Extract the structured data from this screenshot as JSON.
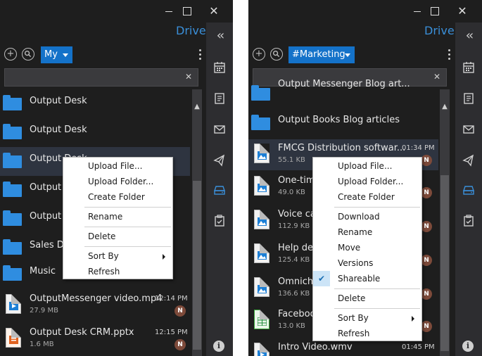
{
  "panel1": {
    "title": "Drive",
    "dropdown": "My",
    "search": {
      "value": "",
      "placeholder": ""
    },
    "items": [
      {
        "name": "Output Desk",
        "type": "folder"
      },
      {
        "name": "Output Desk",
        "type": "folder"
      },
      {
        "name": "Output Desk",
        "type": "folder"
      },
      {
        "name": "Output T",
        "type": "folder"
      },
      {
        "name": "Output",
        "type": "folder"
      },
      {
        "name": "Sales Da",
        "type": "folder"
      },
      {
        "name": "Music",
        "type": "folder"
      },
      {
        "name": "OutputMessenger video.mp4",
        "type": "video",
        "time": "12:14 PM",
        "size": "27.9 MB",
        "badge": "N"
      },
      {
        "name": "Output Desk CRM.pptx",
        "type": "pptx",
        "time": "12:15 PM",
        "size": "1.6 MB",
        "badge": "N"
      }
    ],
    "menu": [
      {
        "label": "Upload File..."
      },
      {
        "label": "Upload Folder..."
      },
      {
        "label": "Create Folder"
      },
      {
        "label": "Rename"
      },
      {
        "label": "Delete"
      },
      {
        "label": "Sort By",
        "submenu": true
      },
      {
        "label": "Refresh"
      }
    ]
  },
  "panel2": {
    "title": "Drive",
    "dropdown": "#Marketing",
    "search": {
      "value": "",
      "placeholder": ""
    },
    "items": [
      {
        "name": "Output Messenger Blog art...",
        "type": "folder"
      },
      {
        "name": "Output Books Blog articles",
        "type": "folder"
      },
      {
        "name": "FMCG Distribution softwar...",
        "type": "image",
        "time": "01:34 PM",
        "size": "55.1 KB",
        "badge": "N"
      },
      {
        "name": "One-tim",
        "type": "image",
        "size": "49.0 KB",
        "badge": "N"
      },
      {
        "name": "Voice ca",
        "type": "image",
        "size": "112.9 KB",
        "badge": "N"
      },
      {
        "name": "Help des",
        "type": "image",
        "size": "125.4 KB",
        "badge": "N"
      },
      {
        "name": "Omnicha",
        "type": "image",
        "size": "136.6 KB",
        "badge": "N"
      },
      {
        "name": "Faceboo",
        "type": "sheet",
        "size": "13.0 KB",
        "badge": "N"
      },
      {
        "name": "Intro Video.wmv",
        "type": "video",
        "time": "01:45 PM"
      }
    ],
    "menu": [
      {
        "label": "Upload File..."
      },
      {
        "label": "Upload Folder..."
      },
      {
        "label": "Create Folder"
      },
      {
        "label": "Download"
      },
      {
        "label": "Rename"
      },
      {
        "label": "Move"
      },
      {
        "label": "Versions"
      },
      {
        "label": "Shareable",
        "checked": true
      },
      {
        "label": "Delete"
      },
      {
        "label": "Sort By",
        "submenu": true
      },
      {
        "label": "Refresh"
      }
    ]
  },
  "sidebar_icons": [
    "collapse-icon",
    "calendar-icon",
    "notes-icon",
    "mail-icon",
    "announcement-icon",
    "drive-icon",
    "tasks-icon",
    "info-icon"
  ],
  "colors": {
    "accent": "#1472c9",
    "link": "#3a8fd9",
    "folder": "#2f8de0",
    "background": "#1e1e1e",
    "sidebar": "#2d2d30",
    "badge": "#7d4a3a"
  }
}
